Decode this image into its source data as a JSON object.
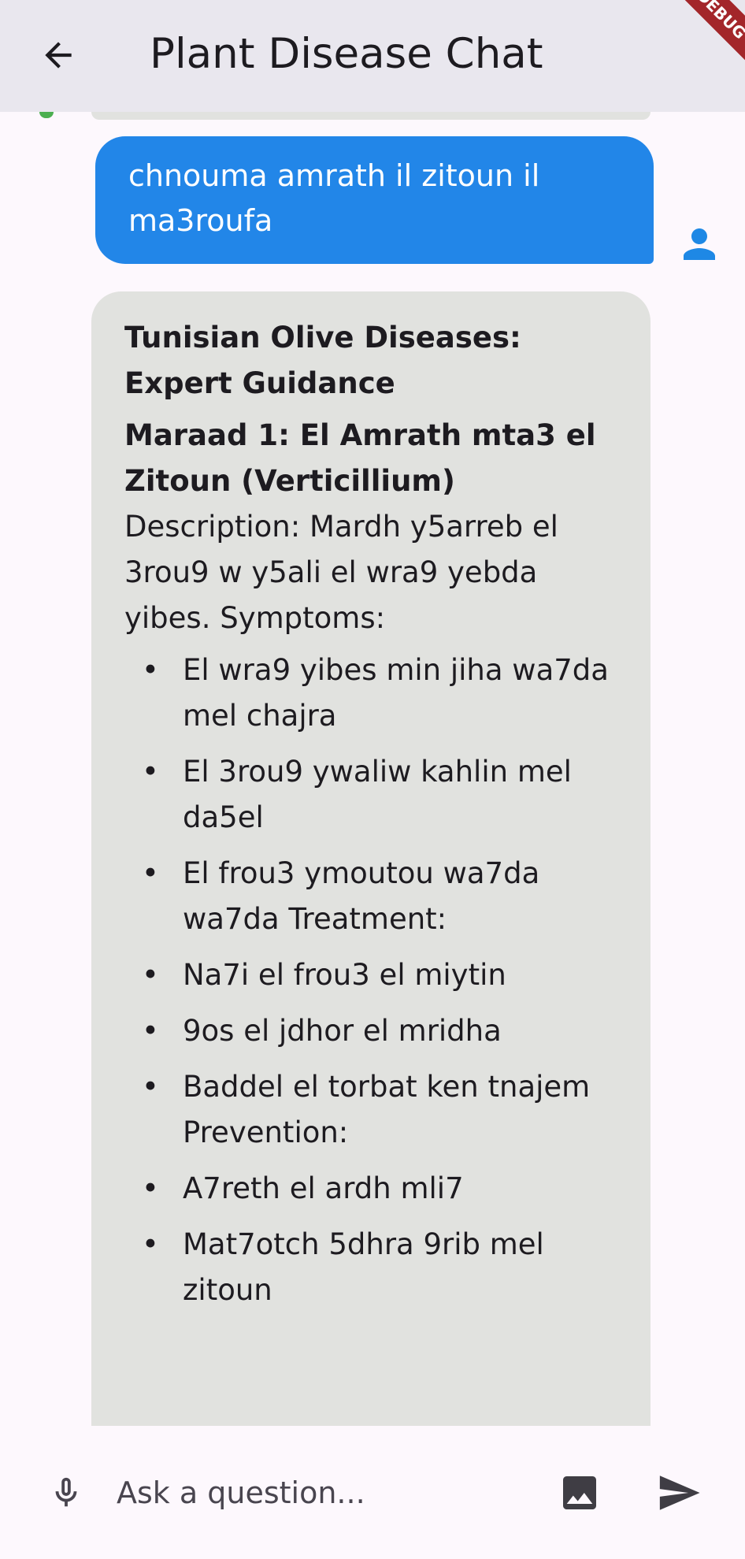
{
  "appbar": {
    "title": "Plant Disease Chat",
    "back_icon": "arrow-back-icon",
    "debug_banner": "DEBUG"
  },
  "messages": {
    "user": {
      "text": "chnouma amrath il zitoun il ma3roufa",
      "avatar_icon": "person-icon"
    },
    "bot": {
      "heading": "Tunisian Olive Diseases: Expert Guidance",
      "subheading": "Maraad 1: El Amrath mta3 el Zitoun (Verticillium)",
      "description": "Description: Mardh y5arreb el 3rou9 w y5ali el wra9 yebda yibes. Symptoms:",
      "bullet_glyph": "•",
      "bullets": [
        "El wra9 yibes min jiha wa7da mel chajra",
        "El 3rou9 ywaliw kahlin mel da5el",
        "El frou3 ymoutou wa7da wa7da Treatment:",
        "Na7i el frou3 el miytin",
        "9os el jdhor el mridha",
        "Baddel el torbat ken tnajem Prevention:",
        "A7reth el ardh mli7",
        "Mat7otch 5dhra 9rib mel zitoun"
      ]
    }
  },
  "input": {
    "placeholder": "Ask a question...",
    "mic_icon": "mic-icon",
    "image_icon": "image-icon",
    "send_icon": "send-icon"
  },
  "colors": {
    "appbar_bg": "#e9e7ee",
    "user_bubble": "#2286e8",
    "bot_bubble": "#e1e2df",
    "accent": "#1e88e5",
    "background": "#fdf8fd",
    "debug_ribbon": "#a3262a"
  }
}
